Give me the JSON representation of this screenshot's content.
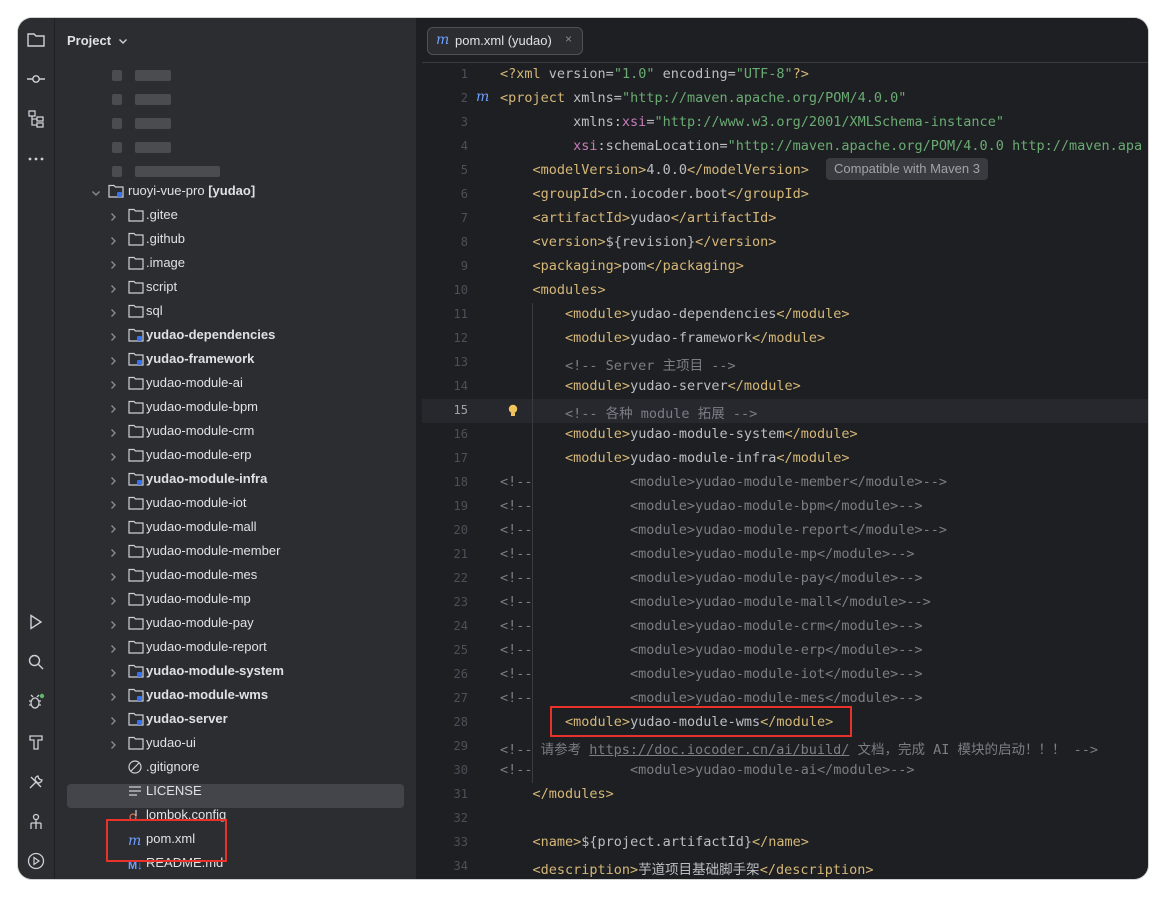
{
  "sidebar": {
    "title": "Project",
    "project_root": "ruoyi-vue-pro",
    "project_module": "[yudao]",
    "items": [
      {
        "label": ".gitee",
        "type": "folder",
        "bold": false
      },
      {
        "label": ".github",
        "type": "folder",
        "bold": false
      },
      {
        "label": ".image",
        "type": "folder",
        "bold": false
      },
      {
        "label": "script",
        "type": "folder",
        "bold": false
      },
      {
        "label": "sql",
        "type": "folder",
        "bold": false
      },
      {
        "label": "yudao-dependencies",
        "type": "module",
        "bold": true
      },
      {
        "label": "yudao-framework",
        "type": "module",
        "bold": true
      },
      {
        "label": "yudao-module-ai",
        "type": "folder",
        "bold": false
      },
      {
        "label": "yudao-module-bpm",
        "type": "folder",
        "bold": false
      },
      {
        "label": "yudao-module-crm",
        "type": "folder",
        "bold": false
      },
      {
        "label": "yudao-module-erp",
        "type": "folder",
        "bold": false
      },
      {
        "label": "yudao-module-infra",
        "type": "module",
        "bold": true
      },
      {
        "label": "yudao-module-iot",
        "type": "folder",
        "bold": false
      },
      {
        "label": "yudao-module-mall",
        "type": "folder",
        "bold": false
      },
      {
        "label": "yudao-module-member",
        "type": "folder",
        "bold": false
      },
      {
        "label": "yudao-module-mes",
        "type": "folder",
        "bold": false
      },
      {
        "label": "yudao-module-mp",
        "type": "folder",
        "bold": false
      },
      {
        "label": "yudao-module-pay",
        "type": "folder",
        "bold": false
      },
      {
        "label": "yudao-module-report",
        "type": "folder",
        "bold": false
      },
      {
        "label": "yudao-module-system",
        "type": "module",
        "bold": true
      },
      {
        "label": "yudao-module-wms",
        "type": "module",
        "bold": true
      },
      {
        "label": "yudao-server",
        "type": "module",
        "bold": true
      },
      {
        "label": "yudao-ui",
        "type": "folder",
        "bold": false
      },
      {
        "label": ".gitignore",
        "type": "gitignore",
        "bold": false
      },
      {
        "label": "LICENSE",
        "type": "text",
        "bold": false
      },
      {
        "label": "lombok.config",
        "type": "config",
        "bold": false
      },
      {
        "label": "pom.xml",
        "type": "maven",
        "bold": false
      },
      {
        "label": "README.md",
        "type": "markdown",
        "bold": false
      }
    ]
  },
  "editor": {
    "tab_icon": "m",
    "tab_label": "pom.xml (yudao)",
    "tab_close": "×",
    "hint": "Compatible with Maven 3",
    "current_line": 15
  },
  "colors": {
    "background": "#1e1f22",
    "sidebar": "#2b2d30",
    "tag": "#d5b778",
    "string": "#6aab73",
    "comment": "#7a7e85",
    "namespace": "#c77dbb",
    "highlight_box": "#e8322a"
  },
  "code_lines": [
    {
      "n": "1",
      "parts": [
        [
          "tag",
          "<?xml "
        ],
        [
          "attr",
          "version="
        ],
        [
          "str",
          "\"1.0\""
        ],
        [
          "attr",
          " encoding="
        ],
        [
          "str",
          "\"UTF-8\""
        ],
        [
          "tag",
          "?>"
        ]
      ]
    },
    {
      "n": "2",
      "parts": [
        [
          "tag",
          "<project "
        ],
        [
          "attr",
          "xmlns="
        ],
        [
          "str",
          "\"http://maven.apache.org/POM/4.0.0\""
        ]
      ]
    },
    {
      "n": "3",
      "parts": [
        [
          "attr",
          "         xmlns:"
        ],
        [
          "ns",
          "xsi"
        ],
        [
          "attr",
          "="
        ],
        [
          "str",
          "\"http://www.w3.org/2001/XMLSchema-instance\""
        ]
      ]
    },
    {
      "n": "4",
      "parts": [
        [
          "attr",
          "         "
        ],
        [
          "ns",
          "xsi"
        ],
        [
          "attr",
          ":schemaLocation="
        ],
        [
          "str",
          "\"http://maven.apache.org/POM/4.0.0 http://maven.apa"
        ]
      ]
    },
    {
      "n": "5",
      "parts": [
        [
          "attr",
          "    "
        ],
        [
          "tag",
          "<modelVersion>"
        ],
        [
          "attr",
          "4.0.0"
        ],
        [
          "tag",
          "</modelVersion>"
        ]
      ]
    },
    {
      "n": "6",
      "parts": [
        [
          "attr",
          "    "
        ],
        [
          "tag",
          "<groupId>"
        ],
        [
          "attr",
          "cn.iocoder.boot"
        ],
        [
          "tag",
          "</groupId>"
        ]
      ]
    },
    {
      "n": "7",
      "parts": [
        [
          "attr",
          "    "
        ],
        [
          "tag",
          "<artifactId>"
        ],
        [
          "attr",
          "yudao"
        ],
        [
          "tag",
          "</artifactId>"
        ]
      ]
    },
    {
      "n": "8",
      "parts": [
        [
          "attr",
          "    "
        ],
        [
          "tag",
          "<version>"
        ],
        [
          "attr",
          "${revision}"
        ],
        [
          "tag",
          "</version>"
        ]
      ]
    },
    {
      "n": "9",
      "parts": [
        [
          "attr",
          "    "
        ],
        [
          "tag",
          "<packaging>"
        ],
        [
          "attr",
          "pom"
        ],
        [
          "tag",
          "</packaging>"
        ]
      ]
    },
    {
      "n": "10",
      "parts": [
        [
          "attr",
          "    "
        ],
        [
          "tag",
          "<modules>"
        ]
      ]
    },
    {
      "n": "11",
      "parts": [
        [
          "attr",
          "        "
        ],
        [
          "tag",
          "<module>"
        ],
        [
          "attr",
          "yudao-dependencies"
        ],
        [
          "tag",
          "</module>"
        ]
      ]
    },
    {
      "n": "12",
      "parts": [
        [
          "attr",
          "        "
        ],
        [
          "tag",
          "<module>"
        ],
        [
          "attr",
          "yudao-framework"
        ],
        [
          "tag",
          "</module>"
        ]
      ]
    },
    {
      "n": "13",
      "parts": [
        [
          "attr",
          "        "
        ],
        [
          "cm",
          "<!-- Server 主项目 -->"
        ]
      ]
    },
    {
      "n": "14",
      "parts": [
        [
          "attr",
          "        "
        ],
        [
          "tag",
          "<module>"
        ],
        [
          "attr",
          "yudao-server"
        ],
        [
          "tag",
          "</module>"
        ]
      ]
    },
    {
      "n": "15",
      "parts": [
        [
          "attr",
          "        "
        ],
        [
          "cm",
          "<!-- 各种 module 拓展 -->"
        ]
      ]
    },
    {
      "n": "16",
      "parts": [
        [
          "attr",
          "        "
        ],
        [
          "tag",
          "<module>"
        ],
        [
          "attr",
          "yudao-module-system"
        ],
        [
          "tag",
          "</module>"
        ]
      ]
    },
    {
      "n": "17",
      "parts": [
        [
          "attr",
          "        "
        ],
        [
          "tag",
          "<module>"
        ],
        [
          "attr",
          "yudao-module-infra"
        ],
        [
          "tag",
          "</module>"
        ]
      ]
    },
    {
      "n": "18",
      "parts": [
        [
          "cm",
          "<!--            <module>yudao-module-member</module>-->"
        ]
      ]
    },
    {
      "n": "19",
      "parts": [
        [
          "cm",
          "<!--            <module>yudao-module-bpm</module>-->"
        ]
      ]
    },
    {
      "n": "20",
      "parts": [
        [
          "cm",
          "<!--            <module>yudao-module-report</module>-->"
        ]
      ]
    },
    {
      "n": "21",
      "parts": [
        [
          "cm",
          "<!--            <module>yudao-module-mp</module>-->"
        ]
      ]
    },
    {
      "n": "22",
      "parts": [
        [
          "cm",
          "<!--            <module>yudao-module-pay</module>-->"
        ]
      ]
    },
    {
      "n": "23",
      "parts": [
        [
          "cm",
          "<!--            <module>yudao-module-mall</module>-->"
        ]
      ]
    },
    {
      "n": "24",
      "parts": [
        [
          "cm",
          "<!--            <module>yudao-module-crm</module>-->"
        ]
      ]
    },
    {
      "n": "25",
      "parts": [
        [
          "cm",
          "<!--            <module>yudao-module-erp</module>-->"
        ]
      ]
    },
    {
      "n": "26",
      "parts": [
        [
          "cm",
          "<!--            <module>yudao-module-iot</module>-->"
        ]
      ]
    },
    {
      "n": "27",
      "parts": [
        [
          "cm",
          "<!--            <module>yudao-module-mes</module>-->"
        ]
      ]
    },
    {
      "n": "28",
      "parts": [
        [
          "attr",
          "        "
        ],
        [
          "tag",
          "<module>"
        ],
        [
          "attr",
          "yudao-module-wms"
        ],
        [
          "tag",
          "</module>"
        ]
      ]
    },
    {
      "n": "29",
      "parts": [
        [
          "cm",
          "<!-- 请参考 "
        ],
        [
          "link",
          "https://doc.iocoder.cn/ai/build/"
        ],
        [
          "cm",
          " 文档，完成 AI 模块的启动！！！ -->"
        ]
      ]
    },
    {
      "n": "30",
      "parts": [
        [
          "cm",
          "<!--            <module>yudao-module-ai</module>-->"
        ]
      ]
    },
    {
      "n": "31",
      "parts": [
        [
          "attr",
          "    "
        ],
        [
          "tag",
          "</modules>"
        ]
      ]
    },
    {
      "n": "32",
      "parts": []
    },
    {
      "n": "33",
      "parts": [
        [
          "attr",
          "    "
        ],
        [
          "tag",
          "<name>"
        ],
        [
          "attr",
          "${project.artifactId}"
        ],
        [
          "tag",
          "</name>"
        ]
      ]
    },
    {
      "n": "34",
      "parts": [
        [
          "attr",
          "    "
        ],
        [
          "tag",
          "<description>"
        ],
        [
          "attr",
          "芋道项目基础脚手架"
        ],
        [
          "tag",
          "</description>"
        ]
      ]
    }
  ]
}
